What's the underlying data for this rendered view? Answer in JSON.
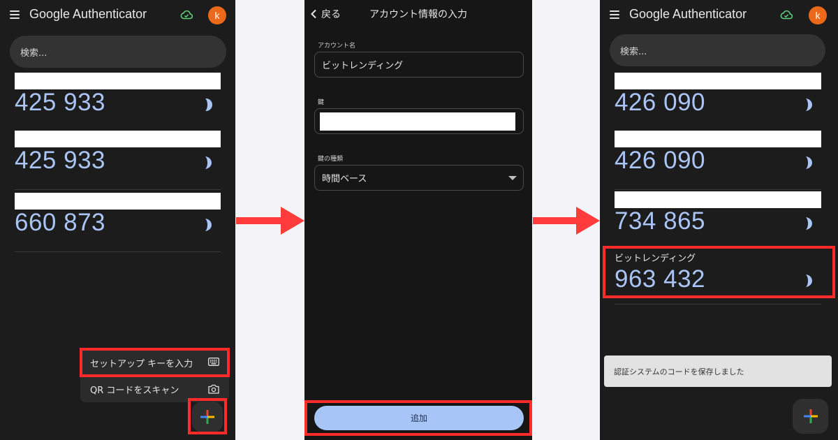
{
  "panel1": {
    "app_title": "Google Authenticator",
    "avatar_letter": "k",
    "search_placeholder": "検索...",
    "accounts": [
      {
        "code": "425 933"
      },
      {
        "code": "425 933"
      },
      {
        "code": "660 873"
      }
    ],
    "fab_menu": {
      "enter_key_label": "セットアップ キーを入力",
      "scan_qr_label": "QR コードをスキャン"
    }
  },
  "panel2": {
    "back_label": "戻る",
    "title": "アカウント情報の入力",
    "account_name_label": "アカウント名",
    "account_name_value": "ビットレンディング",
    "key_label": "鍵",
    "key_type_label": "鍵の種類",
    "key_type_value": "時間ベース",
    "add_button_label": "追加"
  },
  "panel3": {
    "app_title": "Google Authenticator",
    "avatar_letter": "k",
    "search_placeholder": "検索...",
    "accounts": [
      {
        "code": "426 090"
      },
      {
        "code": "426 090"
      },
      {
        "code": "734 865"
      },
      {
        "name": "ビットレンディング",
        "code": "963 432"
      }
    ],
    "snackbar_text": "認証システムのコードを保存しました"
  },
  "colors": {
    "highlight": "#ff2a2a",
    "code_text": "#a9c4f5",
    "avatar": "#ea6a1a",
    "cloud_icon": "#5fd07a",
    "add_button": "#a7c6f7",
    "arrow": "#ff3b3b"
  },
  "icons": [
    "menu-icon",
    "cloud-sync-icon",
    "timer-icon",
    "keyboard-icon",
    "camera-icon",
    "plus-icon",
    "back-chevron-icon",
    "dropdown-caret-icon",
    "right-arrow-icon"
  ]
}
